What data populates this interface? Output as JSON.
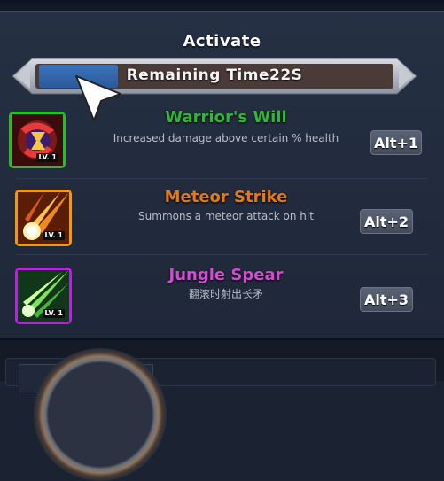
{
  "panel": {
    "title": "Activate"
  },
  "timer": {
    "label": "Remaining Time",
    "value": "22S",
    "progress": 0.22,
    "fill_color": "#3d74b8"
  },
  "skills": [
    {
      "name": "Warrior's Will",
      "description": "Increased damage above certain % health",
      "level": "LV. 1",
      "hotkey": "Alt+1",
      "name_color": "#35b43a",
      "border_color": "#22c21e",
      "icon": "warrior-will-icon",
      "selected": true
    },
    {
      "name": "Meteor Strike",
      "description": "Summons a meteor attack on hit",
      "level": "LV. 1",
      "hotkey": "Alt+2",
      "name_color": "#e07a1c",
      "border_color": "#f09a14",
      "icon": "meteor-strike-icon",
      "selected": false
    },
    {
      "name": "Jungle Spear",
      "description": "翻滚时射出长矛",
      "level": "LV. 1",
      "hotkey": "Alt+3",
      "name_color": "#d24bd2",
      "border_color": "#b028d6",
      "icon": "jungle-spear-icon",
      "selected": false
    }
  ]
}
